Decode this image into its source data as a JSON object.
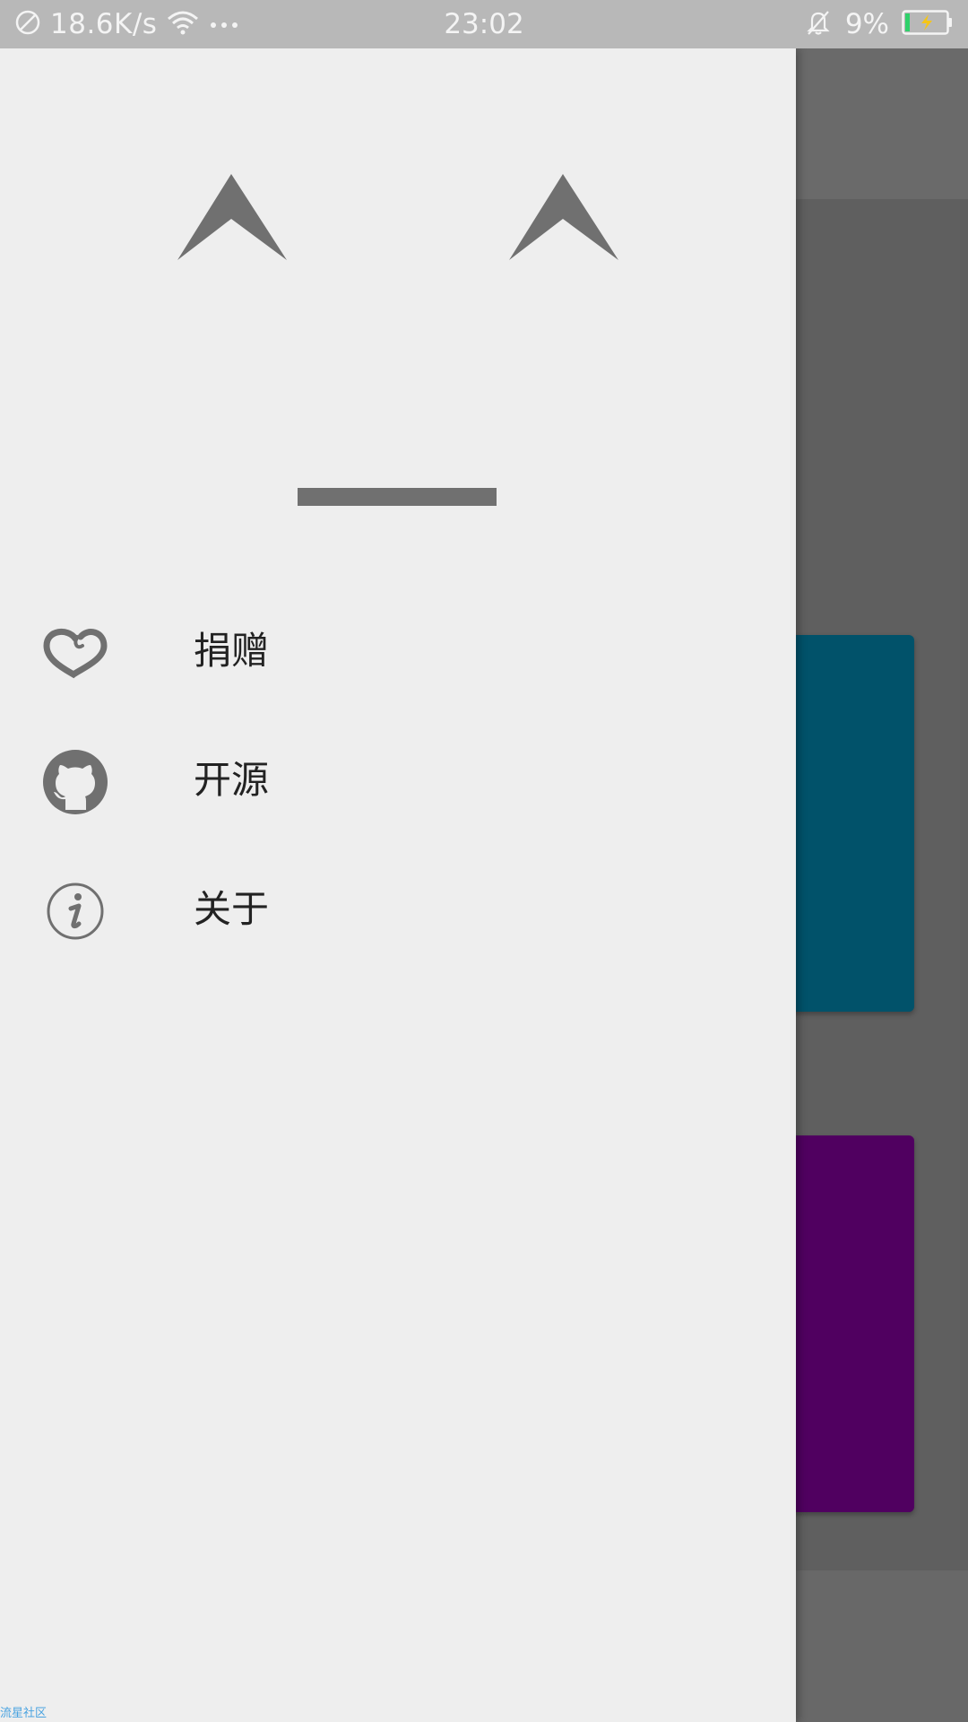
{
  "status_bar": {
    "net_speed": "18.6K/s",
    "time": "23:02",
    "battery": "9%",
    "icons": [
      "blocked-icon",
      "wifi-icon",
      "more-dots-icon",
      "bell-off-icon",
      "battery-charging-icon"
    ]
  },
  "drawer": {
    "header_art": "kaomoji-face",
    "menu": [
      {
        "icon": "heart-icon",
        "label": "捐赠"
      },
      {
        "icon": "github-icon",
        "label": "开源"
      },
      {
        "icon": "info-icon",
        "label": "关于"
      }
    ]
  },
  "watermark": "流星社区",
  "colors": {
    "drawer_bg": "#eeeeee",
    "icon_gray": "#707070",
    "scrim": "#5f5f5f",
    "card_teal": "#01526a",
    "card_purple": "#500060",
    "status_bar": "#b8b8b8"
  }
}
